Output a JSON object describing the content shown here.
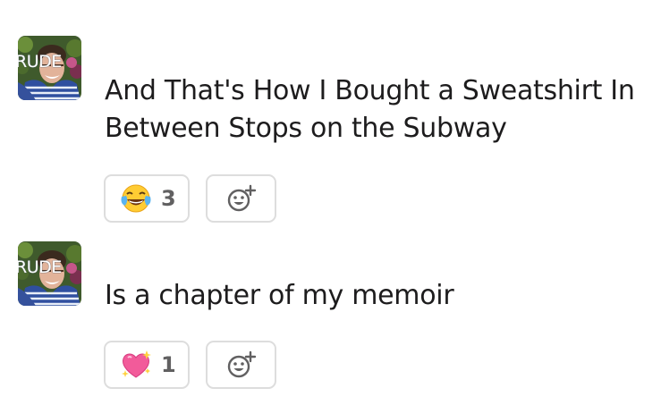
{
  "messages": [
    {
      "avatar_text": "RUDE",
      "text": "And That's How I Bought a Sweatshirt In Between Stops on the Subway",
      "reaction": {
        "emoji": "face-with-tears-of-joy",
        "count": "3"
      }
    },
    {
      "avatar_text": "RUDE",
      "text": "Is a chapter of my memoir",
      "reaction": {
        "emoji": "sparkling-heart",
        "count": "1"
      }
    }
  ],
  "colors": {
    "text": "#1d1c1d",
    "count": "#616061",
    "border": "#dddddd"
  }
}
